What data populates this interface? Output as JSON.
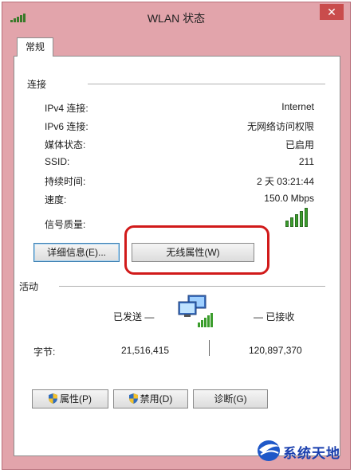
{
  "window": {
    "title": "WLAN 状态",
    "close_label": "✕"
  },
  "tabs": [
    {
      "label": "常规"
    }
  ],
  "connection": {
    "section_title": "连接",
    "rows": [
      {
        "label": "IPv4 连接:",
        "value": "Internet"
      },
      {
        "label": "IPv6 连接:",
        "value": "无网络访问权限"
      },
      {
        "label": "媒体状态:",
        "value": "已启用"
      },
      {
        "label": "SSID:",
        "value": "211"
      },
      {
        "label": "持续时间:",
        "value": "2 天 03:21:44"
      },
      {
        "label": "速度:",
        "value": "150.0 Mbps"
      }
    ],
    "signal_label": "信号质量:",
    "signal_bars": 5,
    "details_button": "详细信息(E)...",
    "wireless_button": "无线属性(W)",
    "highlight_color": "#d11a1a"
  },
  "activity": {
    "section_title": "活动",
    "sent_label": "已发送 —",
    "received_label": "— 已接收",
    "bytes_label": "字节:",
    "bytes_sent": "21,516,415",
    "bytes_received": "120,897,370"
  },
  "buttons": {
    "properties": "属性(P)",
    "disable": "禁用(D)",
    "diagnose": "诊断(G)"
  },
  "watermark": {
    "text": "系统天地"
  },
  "colors": {
    "frame": "#e2a4ab",
    "close": "#c94c4c",
    "signal": "#3b9d2c"
  }
}
